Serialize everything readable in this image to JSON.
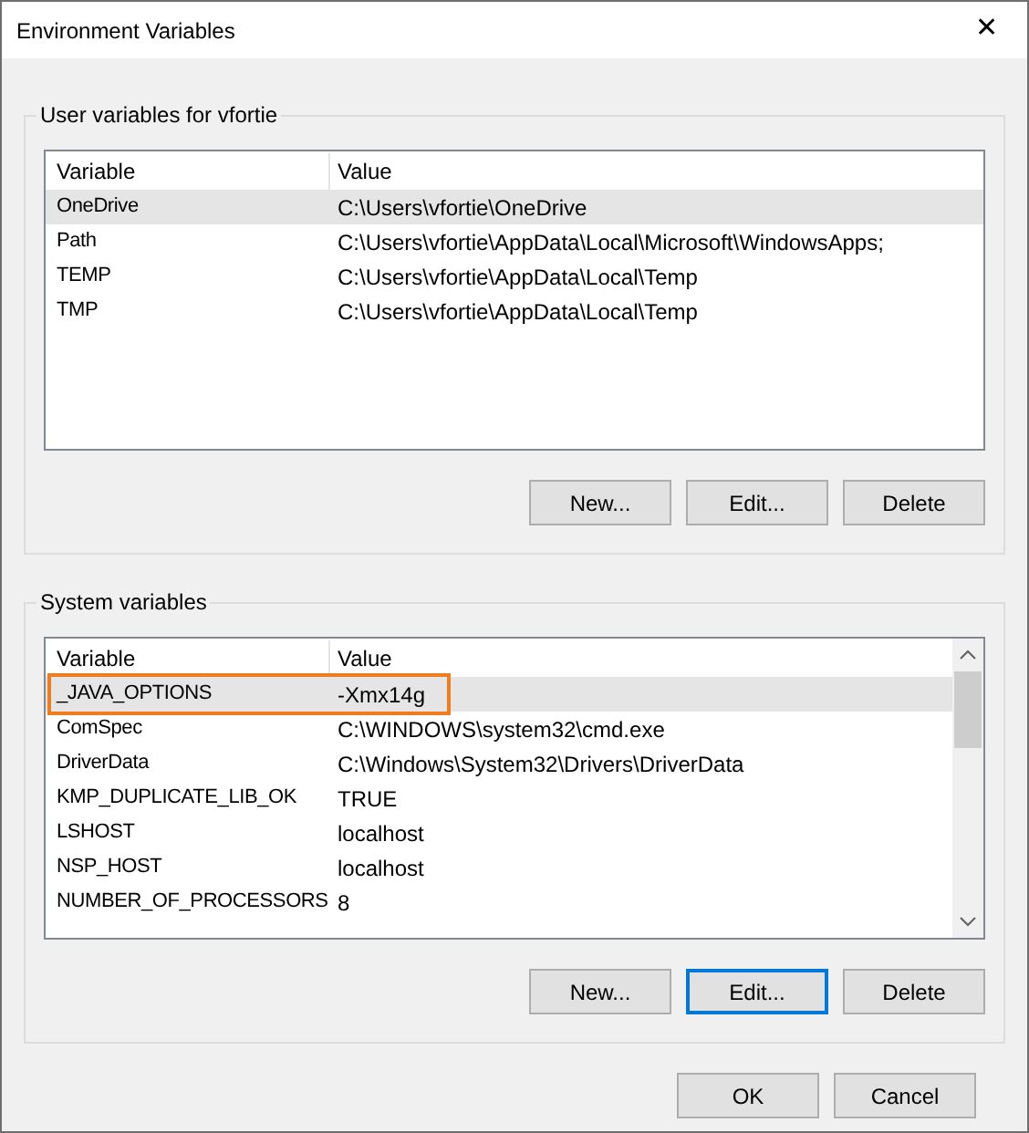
{
  "window": {
    "title": "Environment Variables",
    "close": "✕"
  },
  "user_variables": {
    "label": "User variables for vfortie",
    "columns": [
      "Variable",
      "Value"
    ],
    "rows": [
      {
        "variable": "OneDrive",
        "value": "C:\\Users\\vfortie\\OneDrive",
        "selected": true,
        "annotated": false
      },
      {
        "variable": "Path",
        "value": "C:\\Users\\vfortie\\AppData\\Local\\Microsoft\\WindowsApps;",
        "selected": false,
        "annotated": false
      },
      {
        "variable": "TEMP",
        "value": "C:\\Users\\vfortie\\AppData\\Local\\Temp",
        "selected": false,
        "annotated": false
      },
      {
        "variable": "TMP",
        "value": "C:\\Users\\vfortie\\AppData\\Local\\Temp",
        "selected": false,
        "annotated": false
      }
    ],
    "buttons": [
      {
        "label": "New...",
        "focused": false
      },
      {
        "label": "Edit...",
        "focused": false
      },
      {
        "label": "Delete",
        "focused": false
      }
    ]
  },
  "system_variables": {
    "label": "System variables",
    "columns": [
      "Variable",
      "Value"
    ],
    "rows": [
      {
        "variable": "_JAVA_OPTIONS",
        "value": "-Xmx14g",
        "selected": true,
        "annotated": true
      },
      {
        "variable": "ComSpec",
        "value": "C:\\WINDOWS\\system32\\cmd.exe",
        "selected": false,
        "annotated": false
      },
      {
        "variable": "DriverData",
        "value": "C:\\Windows\\System32\\Drivers\\DriverData",
        "selected": false,
        "annotated": false
      },
      {
        "variable": "KMP_DUPLICATE_LIB_OK",
        "value": "TRUE",
        "selected": false,
        "annotated": false
      },
      {
        "variable": "LSHOST",
        "value": "localhost",
        "selected": false,
        "annotated": false
      },
      {
        "variable": "NSP_HOST",
        "value": "localhost",
        "selected": false,
        "annotated": false
      },
      {
        "variable": "NUMBER_OF_PROCESSORS",
        "value": "8",
        "selected": false,
        "annotated": false
      }
    ],
    "buttons": [
      {
        "label": "New...",
        "focused": false
      },
      {
        "label": "Edit...",
        "focused": true
      },
      {
        "label": "Delete",
        "focused": false
      }
    ]
  },
  "buttons": [
    {
      "label": "OK",
      "focused": false
    },
    {
      "label": "Cancel",
      "focused": false
    }
  ]
}
